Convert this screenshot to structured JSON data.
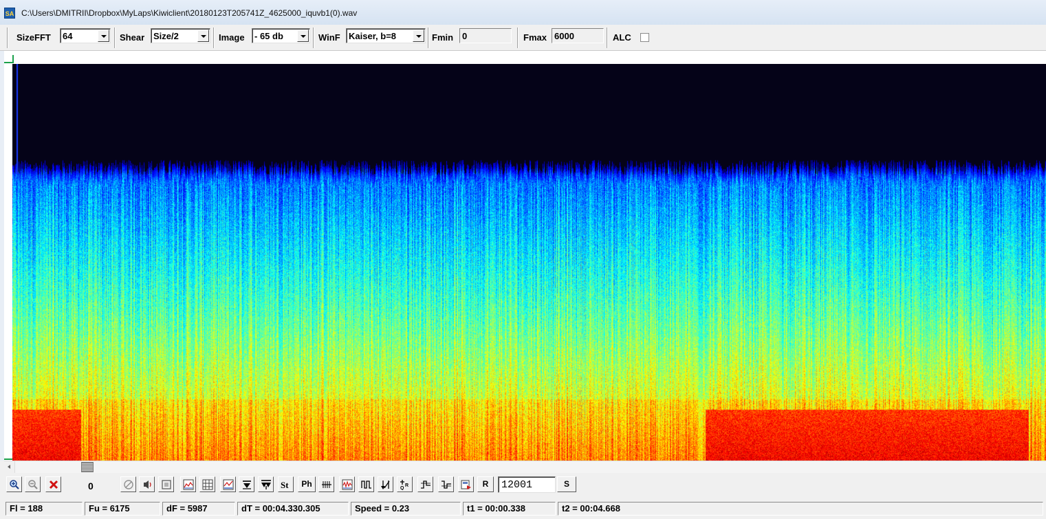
{
  "window": {
    "icon_text": "SA",
    "title": "C:\\Users\\DMITRII\\Dropbox\\MyLaps\\Kiwiclient\\20180123T205741Z_4625000_iquvb1(0).wav"
  },
  "toolbar": {
    "sizefft_label": "SizeFFT",
    "sizefft_value": "64",
    "shear_label": "Shear",
    "shear_value": "Size/2",
    "image_label": "Image",
    "image_value": "- 65 db",
    "winf_label": "WinF",
    "winf_value": "Kaiser, b=8",
    "fmin_label": "Fmin",
    "fmin_value": "0",
    "fmax_label": "Fmax",
    "fmax_value": "6000",
    "alc_label": "ALC",
    "alc_checked": false
  },
  "bottom_toolbar": {
    "counter": "0",
    "ph_label": "Ph",
    "r_label": "R",
    "s_label": "S",
    "rate_value": "12001",
    "icons": [
      "zoom-in-icon",
      "zoom-out-icon",
      "close-x-icon",
      "stop-icon",
      "speaker-icon",
      "square-icon",
      "spectrum-icon",
      "grid-icon",
      "chart-icon",
      "arrow-down-icon",
      "double-arrow-icon",
      "st-icon",
      "ph-icon",
      "comb-icon",
      "waveform-icon",
      "pulse-icon",
      "sort-icon",
      "qr-icon",
      "step-icon",
      "step2-icon",
      "save-icon"
    ]
  },
  "status": {
    "fl": "Fl = 188",
    "fu": "Fu = 6175",
    "df": "dF = 5987",
    "dt": "dT = 00:04.330.305",
    "speed": "Speed = 0.23",
    "t1": "t1 = 00:00.338",
    "t2": "t2 = 00:04.668"
  },
  "colors": {
    "spectrogram_bg": "#050318",
    "cursor": "#1aa04a"
  }
}
